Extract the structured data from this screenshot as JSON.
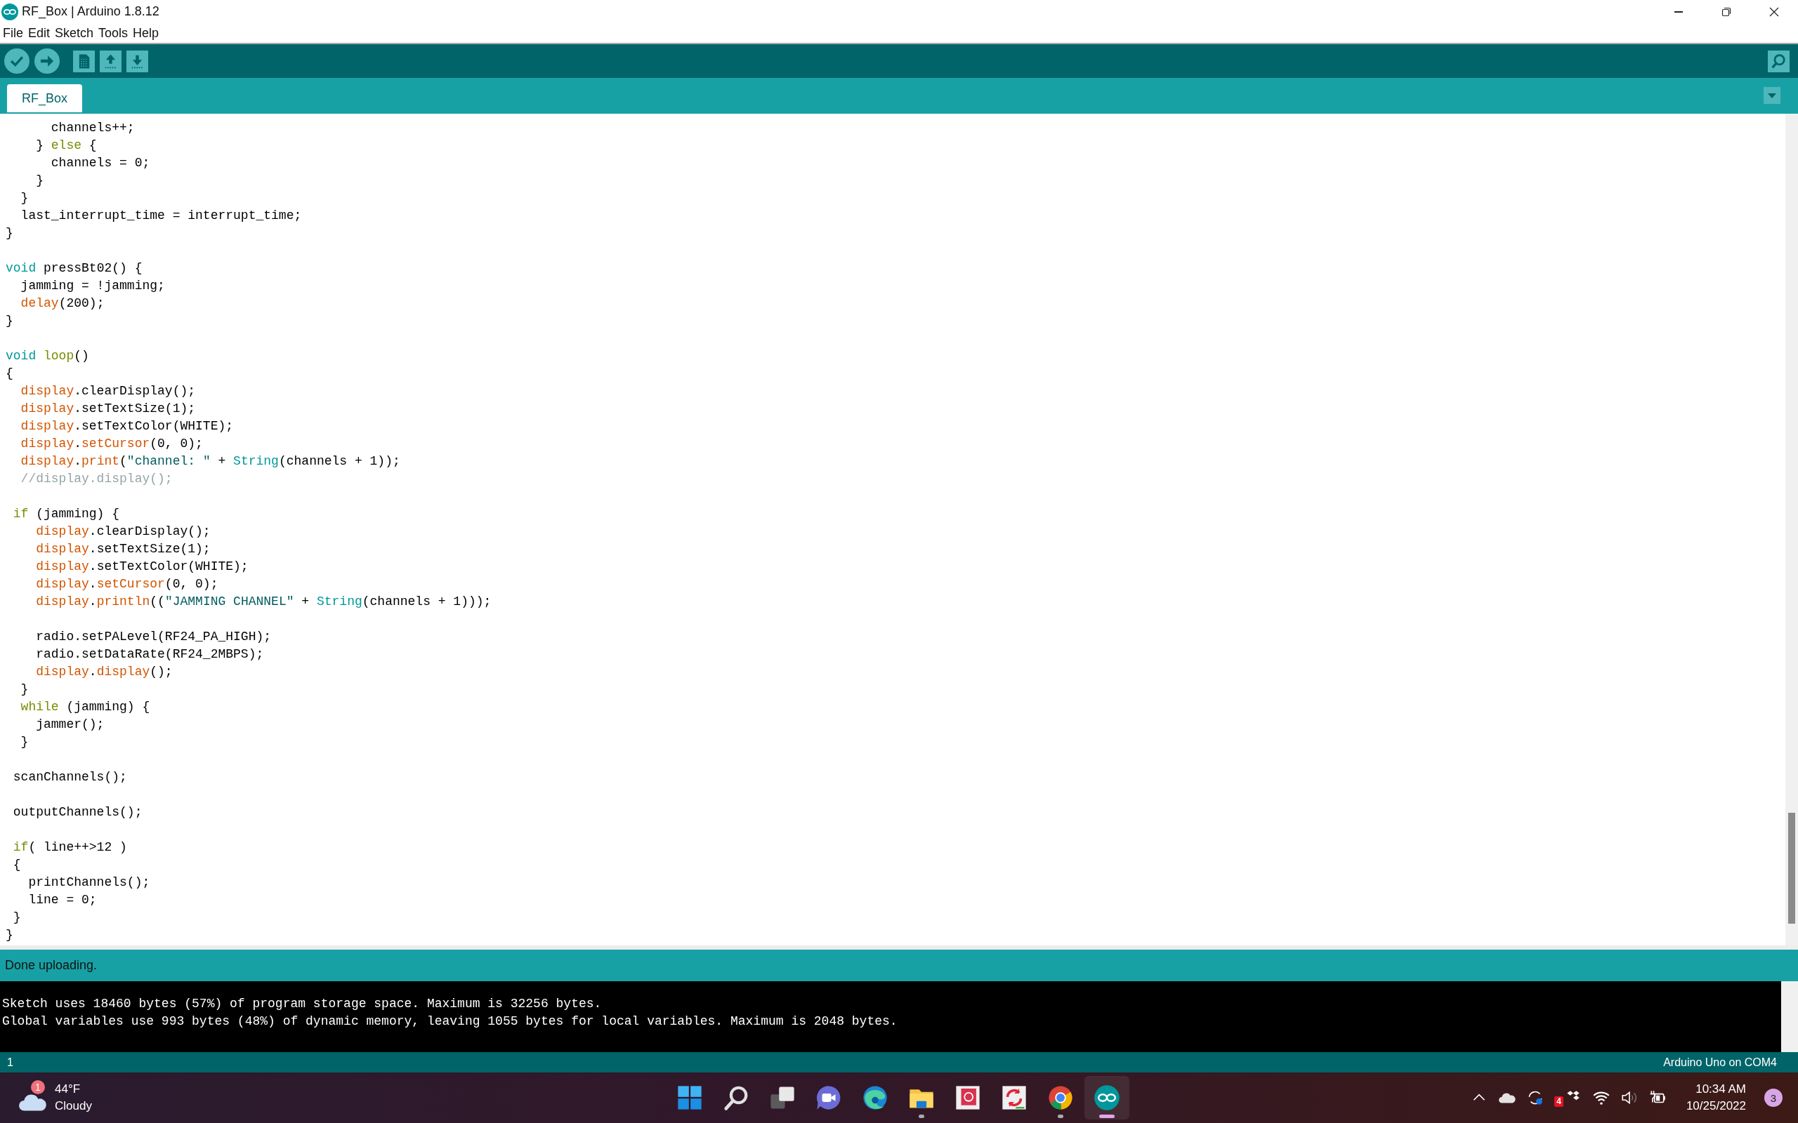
{
  "window": {
    "title": "RF_Box | Arduino 1.8.12"
  },
  "menu": [
    "File",
    "Edit",
    "Sketch",
    "Tools",
    "Help"
  ],
  "tabs": [
    {
      "label": "RF_Box",
      "selected": true
    }
  ],
  "editor": {
    "lines": [
      {
        "kind": "code",
        "segs": [
          {
            "t": "      channels++;",
            "kind": "plain"
          }
        ]
      },
      {
        "kind": "code",
        "segs": [
          {
            "t": "    }",
            "kind": "plain"
          },
          {
            "t": " else",
            "kind": "keyword"
          },
          {
            "t": " {",
            "kind": "plain"
          }
        ]
      },
      {
        "kind": "code",
        "segs": [
          {
            "t": "      channels = 0;",
            "kind": "plain"
          }
        ]
      },
      {
        "kind": "code",
        "segs": [
          {
            "t": "    }",
            "kind": "plain"
          }
        ]
      },
      {
        "kind": "code",
        "segs": [
          {
            "t": "  }",
            "kind": "plain"
          }
        ]
      },
      {
        "kind": "code",
        "segs": [
          {
            "t": "  last_interrupt_time = interrupt_time;",
            "kind": "plain"
          }
        ]
      },
      {
        "kind": "code",
        "segs": [
          {
            "t": "}",
            "kind": "plain"
          }
        ]
      },
      {
        "kind": "blank"
      },
      {
        "kind": "code",
        "segs": [
          {
            "t": "void",
            "kind": "type"
          },
          {
            "t": " pressBt02() {",
            "kind": "plain"
          }
        ]
      },
      {
        "kind": "code",
        "segs": [
          {
            "t": "  jamming = !jamming;",
            "kind": "plain"
          }
        ]
      },
      {
        "kind": "code",
        "segs": [
          {
            "t": "  delay",
            "kind": "func"
          },
          {
            "t": "(200);",
            "kind": "plain"
          }
        ]
      },
      {
        "kind": "code",
        "segs": [
          {
            "t": "}",
            "kind": "plain"
          }
        ]
      },
      {
        "kind": "blank"
      },
      {
        "kind": "code",
        "segs": [
          {
            "t": "void",
            "kind": "type"
          },
          {
            "t": " loop",
            "kind": "keyword"
          },
          {
            "t": "()",
            "kind": "plain"
          }
        ]
      },
      {
        "kind": "code",
        "segs": [
          {
            "t": "{",
            "kind": "plain"
          }
        ]
      },
      {
        "kind": "code",
        "segs": [
          {
            "t": "  display",
            "kind": "func"
          },
          {
            "t": ".clearDisplay();",
            "kind": "plain"
          }
        ]
      },
      {
        "kind": "code",
        "segs": [
          {
            "t": "  display",
            "kind": "func"
          },
          {
            "t": ".setTextSize(1);",
            "kind": "plain"
          }
        ]
      },
      {
        "kind": "code",
        "segs": [
          {
            "t": "  display",
            "kind": "func"
          },
          {
            "t": ".setTextColor(WHITE);",
            "kind": "plain"
          }
        ]
      },
      {
        "kind": "code",
        "segs": [
          {
            "t": "  display",
            "kind": "func"
          },
          {
            "t": ".",
            "kind": "plain"
          },
          {
            "t": "setCursor",
            "kind": "func"
          },
          {
            "t": "(0, 0);",
            "kind": "plain"
          }
        ]
      },
      {
        "kind": "code",
        "segs": [
          {
            "t": "  display",
            "kind": "func"
          },
          {
            "t": ".",
            "kind": "plain"
          },
          {
            "t": "print",
            "kind": "func"
          },
          {
            "t": "(",
            "kind": "plain"
          },
          {
            "t": "\"channel: \"",
            "kind": "string"
          },
          {
            "t": " +",
            "kind": "plain"
          },
          {
            "t": " String",
            "kind": "type"
          },
          {
            "t": "(channels + 1));",
            "kind": "plain"
          }
        ]
      },
      {
        "kind": "code",
        "segs": [
          {
            "t": "  //display.display();",
            "kind": "comment"
          }
        ]
      },
      {
        "kind": "blank"
      },
      {
        "kind": "code",
        "segs": [
          {
            "t": " if",
            "kind": "keyword"
          },
          {
            "t": " (jamming) {",
            "kind": "plain"
          }
        ]
      },
      {
        "kind": "code",
        "segs": [
          {
            "t": "    display",
            "kind": "func"
          },
          {
            "t": ".clearDisplay();",
            "kind": "plain"
          }
        ]
      },
      {
        "kind": "code",
        "segs": [
          {
            "t": "    display",
            "kind": "func"
          },
          {
            "t": ".setTextSize(1);",
            "kind": "plain"
          }
        ]
      },
      {
        "kind": "code",
        "segs": [
          {
            "t": "    display",
            "kind": "func"
          },
          {
            "t": ".setTextColor(WHITE);",
            "kind": "plain"
          }
        ]
      },
      {
        "kind": "code",
        "segs": [
          {
            "t": "    display",
            "kind": "func"
          },
          {
            "t": ".",
            "kind": "plain"
          },
          {
            "t": "setCursor",
            "kind": "func"
          },
          {
            "t": "(0, 0);",
            "kind": "plain"
          }
        ]
      },
      {
        "kind": "code",
        "segs": [
          {
            "t": "    display",
            "kind": "func"
          },
          {
            "t": ".",
            "kind": "plain"
          },
          {
            "t": "println",
            "kind": "func"
          },
          {
            "t": "((",
            "kind": "plain"
          },
          {
            "t": "\"JAMMING CHANNEL\"",
            "kind": "string"
          },
          {
            "t": " +",
            "kind": "plain"
          },
          {
            "t": " String",
            "kind": "type"
          },
          {
            "t": "(channels + 1)));",
            "kind": "plain"
          }
        ]
      },
      {
        "kind": "blank"
      },
      {
        "kind": "code",
        "segs": [
          {
            "t": "    radio.setPALevel(RF24_PA_HIGH);",
            "kind": "plain"
          }
        ]
      },
      {
        "kind": "code",
        "segs": [
          {
            "t": "    radio.setDataRate(RF24_2MBPS);",
            "kind": "plain"
          }
        ]
      },
      {
        "kind": "code",
        "segs": [
          {
            "t": "    display",
            "kind": "func"
          },
          {
            "t": ".",
            "kind": "plain"
          },
          {
            "t": "display",
            "kind": "func"
          },
          {
            "t": "();",
            "kind": "plain"
          }
        ]
      },
      {
        "kind": "code",
        "segs": [
          {
            "t": "  }",
            "kind": "plain"
          }
        ]
      },
      {
        "kind": "code",
        "segs": [
          {
            "t": "  while",
            "kind": "keyword"
          },
          {
            "t": " (jamming) {",
            "kind": "plain"
          }
        ]
      },
      {
        "kind": "code",
        "segs": [
          {
            "t": "    jammer();",
            "kind": "plain"
          }
        ]
      },
      {
        "kind": "code",
        "segs": [
          {
            "t": "  }",
            "kind": "plain"
          }
        ]
      },
      {
        "kind": "blank"
      },
      {
        "kind": "code",
        "segs": [
          {
            "t": " scanChannels();",
            "kind": "plain"
          }
        ]
      },
      {
        "kind": "blank"
      },
      {
        "kind": "code",
        "segs": [
          {
            "t": " outputChannels();",
            "kind": "plain"
          }
        ]
      },
      {
        "kind": "blank"
      },
      {
        "kind": "code",
        "segs": [
          {
            "t": " if",
            "kind": "keyword"
          },
          {
            "t": "( line++>12 )",
            "kind": "plain"
          }
        ]
      },
      {
        "kind": "code",
        "segs": [
          {
            "t": " {",
            "kind": "plain"
          }
        ]
      },
      {
        "kind": "code",
        "segs": [
          {
            "t": "   printChannels();",
            "kind": "plain"
          }
        ]
      },
      {
        "kind": "code",
        "segs": [
          {
            "t": "   line = 0;",
            "kind": "plain"
          }
        ]
      },
      {
        "kind": "code",
        "segs": [
          {
            "t": " }",
            "kind": "plain"
          }
        ]
      },
      {
        "kind": "code",
        "segs": [
          {
            "t": "}",
            "kind": "plain"
          }
        ]
      }
    ]
  },
  "status": {
    "message": "Done uploading."
  },
  "console": {
    "lines": [
      "Sketch uses 18460 bytes (57%) of program storage space. Maximum is 32256 bytes.",
      "Global variables use 993 bytes (48%) of dynamic memory, leaving 1055 bytes for local variables. Maximum is 2048 bytes."
    ]
  },
  "footer": {
    "line": "1",
    "board": "Arduino Uno on COM4"
  },
  "taskbar": {
    "weather": {
      "badge": "1",
      "temperature": "44°F",
      "condition": "Cloudy"
    },
    "apps": [
      {
        "kind": "start",
        "running": false,
        "selected": false
      },
      {
        "kind": "search",
        "running": false,
        "selected": false
      },
      {
        "kind": "taskview",
        "running": false,
        "selected": false
      },
      {
        "kind": "chat",
        "running": false,
        "selected": false
      },
      {
        "kind": "browser_wave",
        "running": false,
        "selected": false
      },
      {
        "kind": "folder",
        "running": true,
        "selected": false
      },
      {
        "kind": "help_book",
        "running": false,
        "selected": false
      },
      {
        "kind": "sync_app",
        "running": false,
        "selected": false
      },
      {
        "kind": "browser_ring",
        "running": true,
        "selected": false
      },
      {
        "kind": "arduino",
        "running": true,
        "selected": true
      }
    ],
    "tray": {
      "badge": "4"
    },
    "clock": {
      "time": "10:34 AM",
      "date": "10/25/2022"
    },
    "notifications": "3"
  }
}
